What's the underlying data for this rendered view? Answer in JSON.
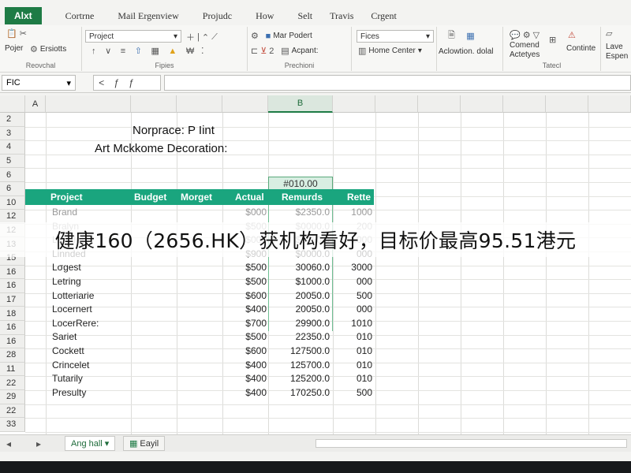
{
  "ribbon_tabs": {
    "file": "Alxt",
    "items": [
      "Cortrne",
      "Mail Ergenview",
      "Projudc",
      "How",
      "Selt",
      "Travis",
      "Crgent"
    ]
  },
  "ribbon": {
    "clipboard": {
      "paste": "Pojer",
      "scripts": "Ersiotts",
      "label": "Reovchal"
    },
    "font": {
      "font_name": "Project",
      "label": "Fipies"
    },
    "alignment": {
      "merge": "Mar Podert",
      "wrap": "Acpant:",
      "label": "Prechioni"
    },
    "number": {
      "format": "Fices",
      "home_center": "Home Center",
      "label": ""
    },
    "styles": {
      "action": "Aclowtion. dolal",
      "commend": "Comend",
      "activity": "Actetyes",
      "label": "Tatecl"
    },
    "cells": {
      "continue": "Continte"
    },
    "editing": {
      "l1": "Lave",
      "l2": "Espen"
    }
  },
  "formula_bar": {
    "name_box": "FIC",
    "fx_glyphs": [
      "<",
      "ƒ",
      "ƒ"
    ],
    "value": ""
  },
  "columns": [
    "A",
    "B"
  ],
  "rows_header_numbers": [
    "2",
    "3",
    "4",
    "5",
    "6",
    "6",
    "10",
    "12",
    "12",
    "13",
    "15",
    "16",
    "16",
    "17",
    "18",
    "16",
    "16",
    "28",
    "11",
    "22",
    "29",
    "22",
    "33"
  ],
  "sheet": {
    "title_line1": "Norprace: P Iint",
    "title_line2": "Art Mckkome Decoration:",
    "selected_value": "#010.00",
    "headers": {
      "project": "Project",
      "budget": "Budget",
      "morget": "Morget",
      "actual": "Actual",
      "remurds": "Remurds",
      "rette": "Rette"
    },
    "rows": [
      {
        "project": "Brand",
        "actual": "$000",
        "remurds": "$2350.0",
        "rette": "1000",
        "faded": true
      },
      {
        "project": "Bralyn",
        "actual": "$500",
        "remurds": "$0000.0",
        "rette": "200",
        "faded": true
      },
      {
        "project": "Letraiet",
        "actual": "$000",
        "remurds": "$1250.0",
        "rette": "1000",
        "faded": true
      },
      {
        "project": "Linnded",
        "actual": "$900",
        "remurds": "$0000.0",
        "rette": "000",
        "faded": false
      },
      {
        "project": "Lσgest",
        "actual": "$500",
        "remurds": "30060.0",
        "rette": "3000",
        "faded": false
      },
      {
        "project": "Letring",
        "actual": "$500",
        "remurds": "$1000.0",
        "rette": "000",
        "faded": false
      },
      {
        "project": "Lotteriarie",
        "actual": "$600",
        "remurds": "20050.0",
        "rette": "500",
        "faded": false
      },
      {
        "project": "Locernert",
        "actual": "$400",
        "remurds": "20050.0",
        "rette": "000",
        "faded": false
      },
      {
        "project": "LocerRere:",
        "actual": "$700",
        "remurds": "29900.0",
        "rette": "1010",
        "faded": false
      },
      {
        "project": "Sariet",
        "actual": "$500",
        "remurds": "22350.0",
        "rette": "010",
        "faded": false
      },
      {
        "project": "Cockett",
        "actual": "$600",
        "remurds": "127500.0",
        "rette": "010",
        "faded": false
      },
      {
        "project": "Crincelet",
        "actual": "$400",
        "remurds": "125700.0",
        "rette": "010",
        "faded": false
      },
      {
        "project": "Tutarily",
        "actual": "$400",
        "remurds": "125200.0",
        "rette": "010",
        "faded": false
      },
      {
        "project": "Presulty",
        "actual": "$400",
        "remurds": "170250.0",
        "rette": "500",
        "faded": false
      }
    ]
  },
  "overlay_caption": "健康160（2656.HK）获机构看好，目标价最高95.51港元",
  "sheet_tabs": [
    {
      "label": "Ang hall",
      "active": true
    },
    {
      "label": "Eayil",
      "active": false
    }
  ],
  "colors": {
    "excel_green": "#1e7b45",
    "header_band": "#1aa57e",
    "selection": "#d8eee2"
  }
}
